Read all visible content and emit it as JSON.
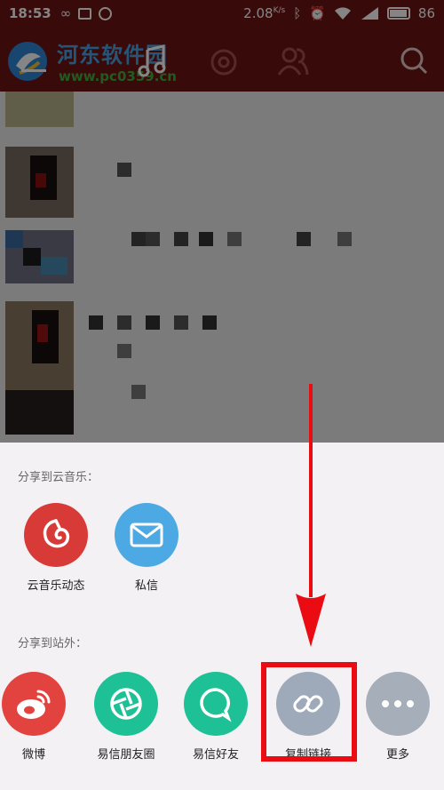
{
  "status_bar": {
    "time": "18:53",
    "net_speed": "2.08",
    "net_speed_unit": "K/s",
    "battery": "86"
  },
  "watermark": {
    "title": "河东软件园",
    "url": "www.pc0359.cn"
  },
  "share_sheet": {
    "section_cloud": "分享到云音乐：",
    "cloud_items": [
      {
        "label": "云音乐动态",
        "icon": "netease-music-icon",
        "color": "#d83a37"
      },
      {
        "label": "私信",
        "icon": "envelope-icon",
        "color": "#4ca9e3"
      }
    ],
    "section_external": "分享到站外：",
    "external_items": [
      {
        "label": "微博",
        "icon": "weibo-icon",
        "color": "#e3433f"
      },
      {
        "label": "易信朋友圈",
        "icon": "yixin-moments-icon",
        "color": "#1ec195"
      },
      {
        "label": "易信好友",
        "icon": "yixin-friend-icon",
        "color": "#1ec195"
      },
      {
        "label": "复制链接",
        "icon": "link-icon",
        "color": "#9ea9b9"
      },
      {
        "label": "更多",
        "icon": "more-dots-icon",
        "color": "#a6aeb9"
      }
    ]
  },
  "colors": {
    "highlight": "#ea0c12",
    "topbar": "#6e1414"
  }
}
